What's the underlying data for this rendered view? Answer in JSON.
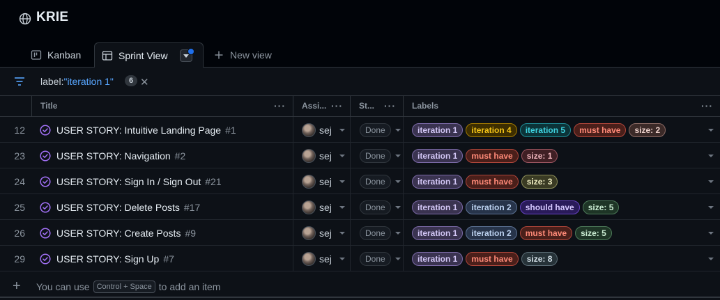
{
  "project": {
    "title": "KRIE",
    "icon": "globe-icon"
  },
  "tabs": [
    {
      "label": "Kanban",
      "icon": "board-icon"
    },
    {
      "label": "Sprint View",
      "icon": "table-icon",
      "active": true
    },
    {
      "label": "New view",
      "icon": "plus-icon"
    }
  ],
  "filter": {
    "prefix": "label:",
    "value": "\"iteration 1\"",
    "count": "6",
    "clear": "✕"
  },
  "columns": {
    "title": "Title",
    "assignees": "Assi...",
    "status": "St...",
    "labels": "Labels",
    "more": "···"
  },
  "label_colors": {
    "iteration 1": {
      "bg": "#3a3350",
      "border": "#7c6aa8",
      "fg": "#d2c6f5"
    },
    "iteration 2": {
      "bg": "#27344a",
      "border": "#5d7294",
      "fg": "#bcd2f0"
    },
    "iteration 4": {
      "bg": "#3d2e00",
      "border": "#a37a00",
      "fg": "#f5c518"
    },
    "iteration 5": {
      "bg": "#0c3338",
      "border": "#1f8a94",
      "fg": "#3fd3e0"
    },
    "must have": {
      "bg": "#4a1f1a",
      "border": "#b0463a",
      "fg": "#ff8a78"
    },
    "should have": {
      "bg": "#2a1b5a",
      "border": "#6744c4",
      "fg": "#d6c8ff"
    },
    "size: 1": {
      "bg": "#3f1f24",
      "border": "#9c5560",
      "fg": "#f0b5bd"
    },
    "size: 2": {
      "bg": "#3b2a28",
      "border": "#8c6b65",
      "fg": "#eed2cc"
    },
    "size: 3": {
      "bg": "#3a3b24",
      "border": "#8f915b",
      "fg": "#f3f1c4"
    },
    "size: 5": {
      "bg": "#1e3526",
      "border": "#4d7a59",
      "fg": "#c9ebd1"
    },
    "size: 8": {
      "bg": "#263238",
      "border": "#5b6c75",
      "fg": "#d4e1e8"
    }
  },
  "rows": [
    {
      "num": "12",
      "title": "USER STORY: Intuitive Landing Page",
      "issue": "#1",
      "assignee": "sej",
      "status": "Done",
      "labels": [
        "iteration 1",
        "iteration 4",
        "iteration 5",
        "must have",
        "size: 2"
      ]
    },
    {
      "num": "23",
      "title": "USER STORY: Navigation",
      "issue": "#2",
      "assignee": "sej",
      "status": "Done",
      "labels": [
        "iteration 1",
        "must have",
        "size: 1"
      ]
    },
    {
      "num": "24",
      "title": "USER STORY: Sign In / Sign Out",
      "issue": "#21",
      "assignee": "sej",
      "status": "Done",
      "labels": [
        "iteration 1",
        "must have",
        "size: 3"
      ]
    },
    {
      "num": "25",
      "title": "USER STORY: Delete Posts",
      "issue": "#17",
      "assignee": "sej",
      "status": "Done",
      "labels": [
        "iteration 1",
        "iteration 2",
        "should have",
        "size: 5"
      ]
    },
    {
      "num": "26",
      "title": "USER STORY: Create Posts",
      "issue": "#9",
      "assignee": "sej",
      "status": "Done",
      "labels": [
        "iteration 1",
        "iteration 2",
        "must have",
        "size: 5"
      ]
    },
    {
      "num": "29",
      "title": "USER STORY: Sign Up",
      "issue": "#7",
      "assignee": "sej",
      "status": "Done",
      "labels": [
        "iteration 1",
        "must have",
        "size: 8"
      ]
    }
  ],
  "footer": {
    "plus": "+",
    "pre": "You can use",
    "key": "Control + Space",
    "post": "to add an item"
  }
}
